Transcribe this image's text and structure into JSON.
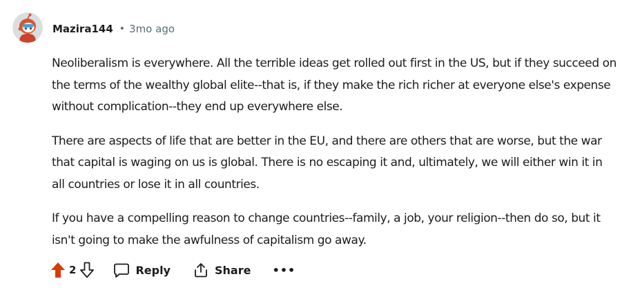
{
  "comment": {
    "author": "Mazira144",
    "separator": "•",
    "time_ago": "3mo ago",
    "paragraphs": [
      "Neoliberalism is everywhere. All the terrible ideas get rolled out first in the US, but if they succeed on the terms of the wealthy global elite--that is, if they make the rich richer at everyone else's expense without complication--they end up everywhere else.",
      "There are aspects of life that are better in the EU, and there are others that are worse, but the war that capital is waging on us is global. There is no escaping it and, ultimately, we will either win it in all countries or lose it in all countries.",
      "If you have a compelling reason to change countries--family, a job, your religion--then do so, but it isn't going to make the awfulness of capitalism go away."
    ]
  },
  "actions": {
    "score": "2",
    "upvote_state": "upvoted",
    "reply_label": "Reply",
    "share_label": "Share",
    "more_label": "•••"
  },
  "colors": {
    "upvote_active": "#d93a00",
    "text": "#1c1c1c",
    "meta": "#576f76",
    "avatar_bg": "#dadee0"
  },
  "icons": {
    "avatar": "snoo-avatar-icon",
    "upvote": "upvote-arrow-icon",
    "downvote": "downvote-arrow-icon",
    "reply": "speech-bubble-icon",
    "share": "share-icon",
    "more": "ellipsis-icon"
  }
}
